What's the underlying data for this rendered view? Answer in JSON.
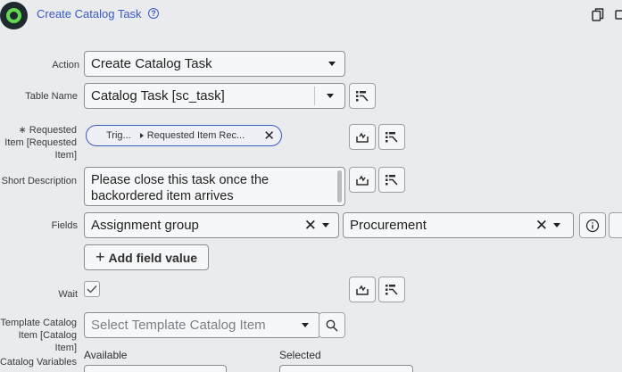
{
  "header": {
    "title": "Create Catalog Task",
    "help_icon": "?"
  },
  "form": {
    "action": {
      "label": "Action",
      "value": "Create Catalog Task"
    },
    "table_name": {
      "label": "Table Name",
      "value": "Catalog Task [sc_task]"
    },
    "requested_item": {
      "label_line1": "∗ Requested",
      "label_line2": "Item [Requested",
      "label_line3": "Item]",
      "pill_part1": "Trig...",
      "pill_part2": "Requested Item Rec..."
    },
    "short_description": {
      "label": "Short Description",
      "line1": "Please close this task once the",
      "line2": "backordered item arrives"
    },
    "fields": {
      "label": "Fields",
      "field_name": "Assignment group",
      "field_value": "Procurement",
      "add_button": "Add field value"
    },
    "wait": {
      "label": "Wait",
      "checked": true
    },
    "template_catalog_item": {
      "label_line1": "Template Catalog",
      "label_line2": "Item [Catalog Item]",
      "placeholder": "Select Template Catalog Item"
    },
    "catalog_variables": {
      "label": "Catalog Variables",
      "available": "Available",
      "selected": "Selected"
    }
  },
  "icons": {
    "logo": "app-logo",
    "copy": "copy-icon",
    "pill_chip": "data-pill-icon",
    "picker": "data-pill-picker-icon",
    "search": "search-icon",
    "info": "info-icon",
    "check": "checkmark-icon"
  },
  "colors": {
    "accent": "#3c59c4",
    "background": "#e9ebed",
    "logo_ring": "#62d84e"
  }
}
